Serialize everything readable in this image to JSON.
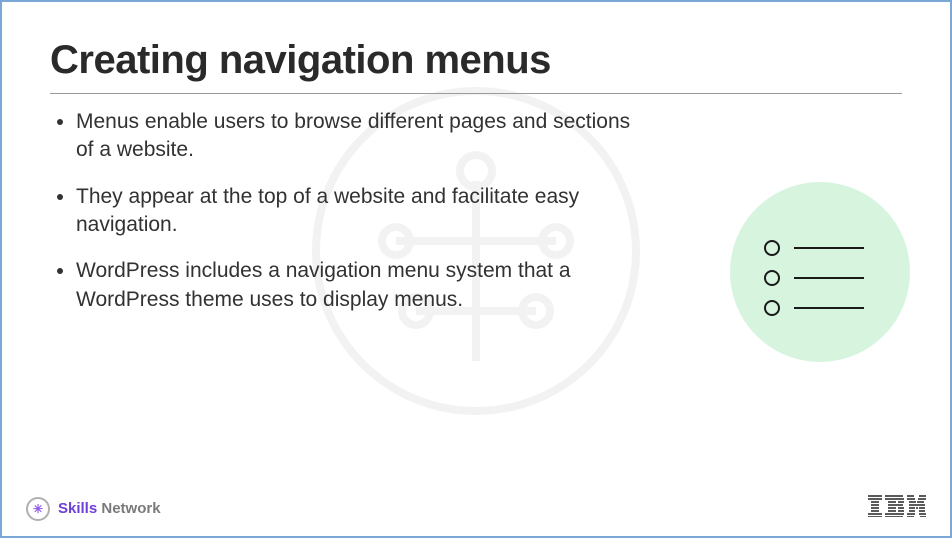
{
  "title": "Creating navigation menus",
  "bullets": [
    "Menus enable users to browse different pages and sections of a website.",
    "They appear at the top of a website and facilitate easy navigation.",
    "WordPress includes a navigation menu system that a WordPress theme uses to display menus."
  ],
  "footer": {
    "skills_bold": "Skills",
    "skills_rest": " Network",
    "right_logo": "IBM"
  }
}
